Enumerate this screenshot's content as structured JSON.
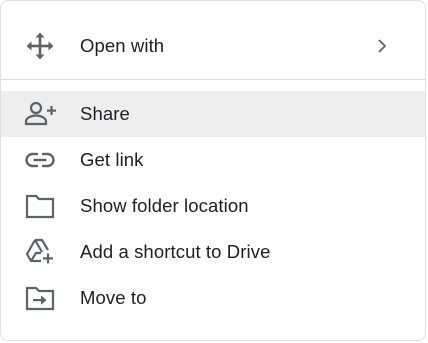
{
  "menu": {
    "open_with": {
      "label": "Open with",
      "icon": "move-arrows-icon",
      "submenu_icon": "chevron-right-icon"
    },
    "items": [
      {
        "label": "Share",
        "icon": "person-add-icon",
        "hovered": true
      },
      {
        "label": "Get link",
        "icon": "link-icon"
      },
      {
        "label": "Show folder location",
        "icon": "folder-icon"
      },
      {
        "label": "Add a shortcut to Drive",
        "icon": "drive-shortcut-icon"
      },
      {
        "label": "Move to",
        "icon": "move-to-folder-icon"
      }
    ]
  },
  "colors": {
    "text": "#202124",
    "icon": "#5f6368",
    "hover_bg": "#eeeeee",
    "divider": "#dadce0",
    "border": "#e0e0e0"
  }
}
